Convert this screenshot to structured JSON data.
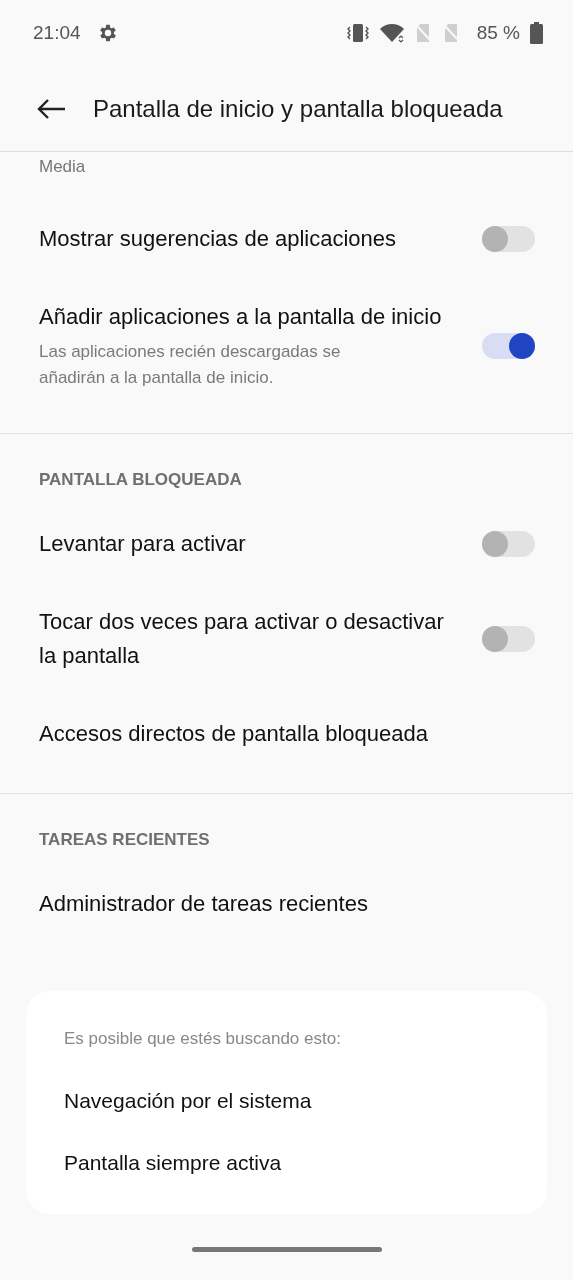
{
  "status_bar": {
    "time": "21:04",
    "battery": "85 %"
  },
  "app_bar": {
    "title": "Pantalla de inicio y pantalla bloqueada"
  },
  "top_caption": "Media",
  "sections": [
    {
      "items": [
        {
          "kind": "toggle",
          "title": "Mostrar sugerencias de aplicaciones",
          "on": false
        },
        {
          "kind": "toggle",
          "title": "Añadir aplicaciones a la pantalla de inicio",
          "subtitle": "Las aplicaciones recién descargadas se añadirán a la pantalla de inicio.",
          "on": true
        }
      ]
    },
    {
      "header": "PANTALLA BLOQUEADA",
      "items": [
        {
          "kind": "toggle",
          "title": "Levantar para activar",
          "on": false
        },
        {
          "kind": "toggle",
          "title": "Tocar dos veces para activar o desactivar la pantalla",
          "on": false
        },
        {
          "kind": "link",
          "title": "Accesos directos de pantalla bloqueada"
        }
      ]
    },
    {
      "header": "TAREAS RECIENTES",
      "items": [
        {
          "kind": "link",
          "title": "Administrador de tareas recientes"
        }
      ]
    }
  ],
  "suggestions": {
    "caption": "Es posible que estés buscando esto:",
    "items": [
      "Navegación por el sistema",
      "Pantalla siempre activa"
    ]
  }
}
